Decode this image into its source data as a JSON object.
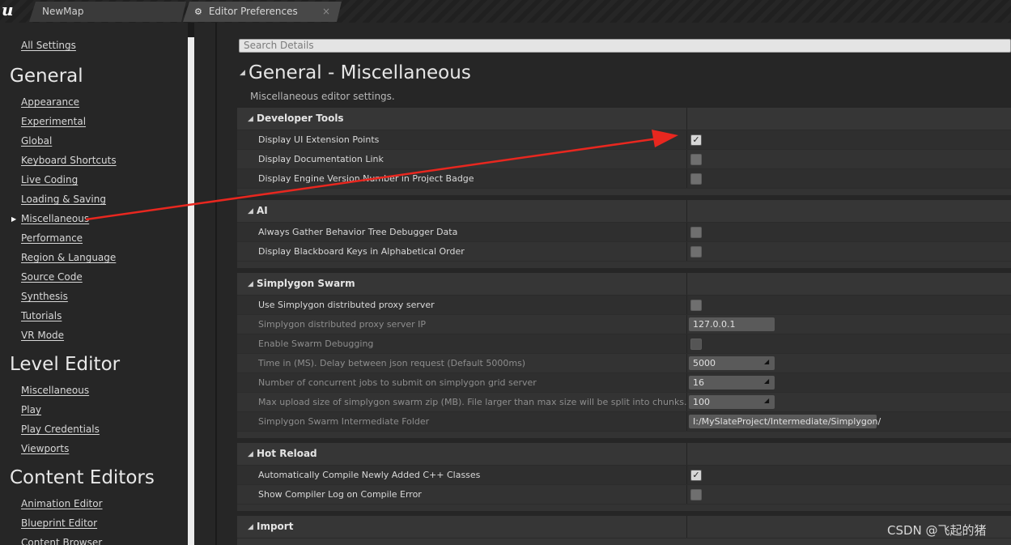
{
  "tabs": [
    {
      "label": "NewMap"
    },
    {
      "label": "Editor Preferences",
      "close": "×"
    }
  ],
  "logo": "u",
  "sidebar": {
    "all_settings": "All Settings",
    "groups": [
      {
        "title": "General",
        "items": [
          "Appearance",
          "Experimental",
          "Global",
          "Keyboard Shortcuts",
          "Live Coding",
          "Loading & Saving",
          "Miscellaneous",
          "Performance",
          "Region & Language",
          "Source Code",
          "Synthesis",
          "Tutorials",
          "VR Mode"
        ]
      },
      {
        "title": "Level Editor",
        "items": [
          "Miscellaneous",
          "Play",
          "Play Credentials",
          "Viewports"
        ]
      },
      {
        "title": "Content Editors",
        "items": [
          "Animation Editor",
          "Blueprint Editor",
          "Content Browser"
        ]
      }
    ],
    "selected": "Miscellaneous"
  },
  "search": {
    "placeholder": "Search Details"
  },
  "page": {
    "title": "General - Miscellaneous",
    "subtitle": "Miscellaneous editor settings."
  },
  "sections": [
    {
      "title": "Developer Tools",
      "rows": [
        {
          "label": "Display UI Extension Points",
          "type": "checkbox",
          "checked": true
        },
        {
          "label": "Display Documentation Link",
          "type": "checkbox",
          "checked": false
        },
        {
          "label": "Display Engine Version Number in Project Badge",
          "type": "checkbox",
          "checked": false
        }
      ]
    },
    {
      "title": "AI",
      "rows": [
        {
          "label": "Always Gather Behavior Tree Debugger Data",
          "type": "checkbox",
          "checked": false
        },
        {
          "label": "Display Blackboard Keys in Alphabetical Order",
          "type": "checkbox",
          "checked": false
        }
      ]
    },
    {
      "title": "Simplygon Swarm",
      "rows": [
        {
          "label": "Use Simplygon distributed proxy server",
          "type": "checkbox",
          "checked": false
        },
        {
          "label": "Simplygon distributed proxy server IP",
          "type": "text",
          "value": "127.0.0.1",
          "disabled": true
        },
        {
          "label": "Enable Swarm Debugging",
          "type": "checkbox",
          "checked": false,
          "disabled": true
        },
        {
          "label": "Time in (MS). Delay between json request (Default 5000ms)",
          "type": "number",
          "value": "5000",
          "disabled": true
        },
        {
          "label": "Number of concurrent jobs to submit on simplygon grid server",
          "type": "number",
          "value": "16",
          "disabled": true
        },
        {
          "label": "Max upload size of simplygon swarm zip (MB). File larger than max size will be split into chunks.",
          "type": "number",
          "value": "100",
          "disabled": true
        },
        {
          "label": "Simplygon Swarm Intermediate Folder",
          "type": "path",
          "value": "I:/MySlateProject/Intermediate/Simplygon/",
          "disabled": true
        }
      ]
    },
    {
      "title": "Hot Reload",
      "rows": [
        {
          "label": "Automatically Compile Newly Added C++ Classes",
          "type": "checkbox",
          "checked": true
        },
        {
          "label": "Show Compiler Log on Compile Error",
          "type": "checkbox",
          "checked": false
        }
      ]
    },
    {
      "title": "Import",
      "rows": []
    }
  ],
  "annotation_color": "#e8271f",
  "watermark": "CSDN @飞起的猪"
}
